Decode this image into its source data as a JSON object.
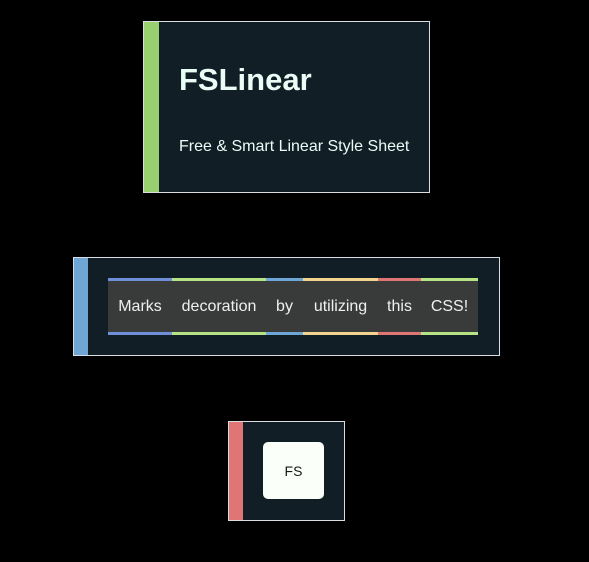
{
  "colors": {
    "background": "#000000",
    "card_background": "#121e25",
    "card_border": "#d7dde1",
    "accent_green": "#99d06f",
    "accent_blue": "#6ea7d6",
    "accent_red": "#e07575",
    "text_light": "#eafcf6"
  },
  "hero": {
    "title": "FSLinear",
    "subtitle": "Free & Smart Linear Style Sheet"
  },
  "marks": {
    "words": [
      {
        "text": "Marks",
        "color": "#6f8fd8"
      },
      {
        "text": "decoration",
        "color": "#b6e383"
      },
      {
        "text": "by",
        "color": "#6ea7d6"
      },
      {
        "text": "utilizing",
        "color": "#f2d48f"
      },
      {
        "text": "this",
        "color": "#e07575"
      },
      {
        "text": "CSS!",
        "color": "#b6e383"
      }
    ]
  },
  "fs_tile": {
    "label": "FS"
  }
}
